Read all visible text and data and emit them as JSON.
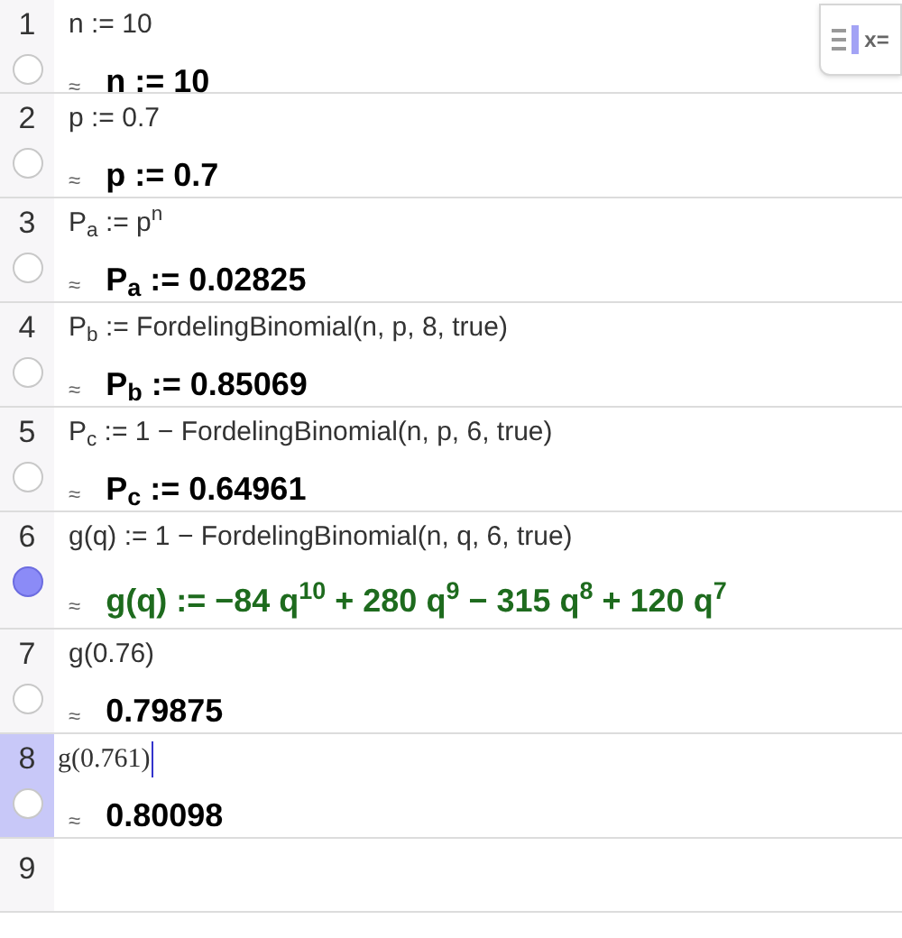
{
  "keyboard_toggle": {
    "label": "x="
  },
  "rows": [
    {
      "number": "1",
      "kind": "entry",
      "input": "n := 10",
      "output": "n := 10",
      "visible": false,
      "selected": false,
      "editing": false
    },
    {
      "number": "2",
      "kind": "entry",
      "input": "p := 0.7",
      "output": "p := 0.7",
      "visible": false,
      "selected": false,
      "editing": false
    },
    {
      "number": "3",
      "kind": "entry",
      "input": "P$_{a}$ := p$^{n}$",
      "output": "P$_{a}$ := 0.02825",
      "visible": false,
      "selected": false,
      "editing": false
    },
    {
      "number": "4",
      "kind": "entry",
      "input": "P$_{b}$ := FordelingBinomial(n,  p,  8,  true)",
      "output": "P$_{b}$ := 0.85069",
      "visible": false,
      "selected": false,
      "editing": false
    },
    {
      "number": "5",
      "kind": "entry",
      "input": "P$_{c}$ := 1 − FordelingBinomial(n,  p,  6,  true)",
      "output": "P$_{c}$ := 0.64961",
      "visible": false,
      "selected": false,
      "editing": false
    },
    {
      "number": "6",
      "kind": "entry",
      "input": "g(q) := 1 − FordelingBinomial(n,  q,  6,  true)",
      "output": "g(q) := −84 q$^{10}$ + 280 q$^{9}$ − 315 q$^{8}$ + 120 q$^{7}$",
      "visible": true,
      "selected": false,
      "editing": false
    },
    {
      "number": "7",
      "kind": "entry",
      "input": "g(0.76)",
      "output": "0.79875",
      "visible": false,
      "selected": false,
      "editing": false
    },
    {
      "number": "8",
      "kind": "entry",
      "input": "g(0.761)",
      "output": "0.80098",
      "visible": false,
      "selected": true,
      "editing": true
    },
    {
      "number": "9",
      "kind": "empty",
      "selected": false
    }
  ],
  "approx_symbol": "≈"
}
